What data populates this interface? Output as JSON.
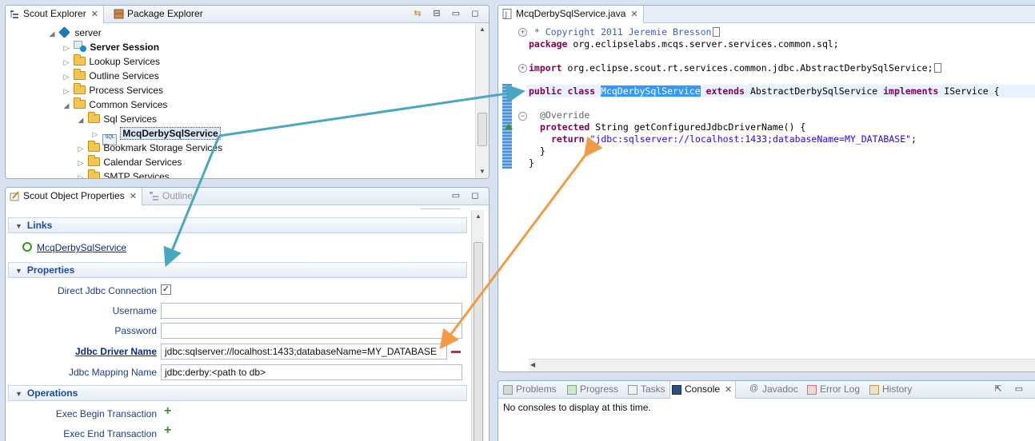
{
  "scout_explorer": {
    "tab_label": "Scout Explorer",
    "other_tab_label": "Package Explorer",
    "tree": [
      {
        "label": "server",
        "level": 0,
        "icon": "project-icon",
        "expanded": true
      },
      {
        "label": "Server Session",
        "level": 1,
        "icon": "service-icon",
        "bold": true,
        "expanded": false
      },
      {
        "label": "Lookup Services",
        "level": 1,
        "icon": "folder-icon",
        "expanded": false
      },
      {
        "label": "Outline Services",
        "level": 1,
        "icon": "folder-icon",
        "expanded": false
      },
      {
        "label": "Process Services",
        "level": 1,
        "icon": "folder-icon",
        "expanded": false
      },
      {
        "label": "Common Services",
        "level": 1,
        "icon": "folder-icon",
        "expanded": true
      },
      {
        "label": "Sql Services",
        "level": 2,
        "icon": "folder-icon",
        "expanded": true
      },
      {
        "label": "McqDerbySqlService",
        "level": 3,
        "icon": "sql-service-icon",
        "selected": true,
        "bold": true
      },
      {
        "label": "Bookmark Storage Services",
        "level": 2,
        "icon": "folder-icon",
        "expanded": false
      },
      {
        "label": "Calendar Services",
        "level": 2,
        "icon": "folder-icon",
        "expanded": false
      },
      {
        "label": "SMTP Services",
        "level": 2,
        "icon": "folder-icon",
        "expanded": false
      }
    ]
  },
  "properties_view": {
    "tab_label": "Scout Object Properties",
    "other_tab_label": "Outline",
    "links_section": "Links",
    "link_label": "McqDerbySqlService",
    "properties_section": "Properties",
    "fields": [
      {
        "label": "Direct Jdbc Connection",
        "type": "checkbox",
        "checked": true
      },
      {
        "label": "Username",
        "type": "text",
        "value": ""
      },
      {
        "label": "Password",
        "type": "text",
        "value": ""
      },
      {
        "label": "Jdbc Driver Name",
        "type": "text",
        "value": "jdbc:sqlserver://localhost:1433;databaseName=MY_DATABASE",
        "link": true
      },
      {
        "label": "Jdbc Mapping Name",
        "type": "text",
        "value": "jdbc:derby:<path to db>"
      }
    ],
    "operations_section": "Operations",
    "operations": [
      "Exec Begin Transaction",
      "Exec End Transaction"
    ]
  },
  "editor": {
    "tab_label": "McqDerbySqlService.java",
    "lines": {
      "l1": " * Copyright 2011 Jeremie Bresson",
      "l2a": "package",
      "l2b": " org.eclipselabs.mcqs.server.services.common.sql;",
      "l3a": "import",
      "l3b": " org.eclipse.scout.rt.services.common.jdbc.AbstractDerbySqlService;",
      "l4a": "public class ",
      "l4b": "McqDerbySqlService",
      "l4c": " extends ",
      "l4d": "AbstractDerbySqlService ",
      "l4e": "implements",
      "l4f": " IService {",
      "l5": "@Override",
      "l6a": "protected",
      "l6b": " String getConfiguredJdbcDriverName() {",
      "l7a": "return",
      "l7b": " \"jdbc:sqlserver://localhost:1433;databaseName=MY_DATABASE\"",
      "l7c": ";",
      "l8": "}",
      "l9": "}"
    }
  },
  "console_view": {
    "tabs": [
      "Problems",
      "Progress",
      "Tasks",
      "Console",
      "Javadoc",
      "Error Log",
      "History"
    ],
    "active_tab": "Console",
    "message": "No consoles to display at this time."
  },
  "colors": {
    "arrow_blue": "#4aa7c2",
    "arrow_orange": "#f39a45",
    "keyword": "#7f0055",
    "string": "#2a00ff",
    "selection": "#3399ff"
  }
}
